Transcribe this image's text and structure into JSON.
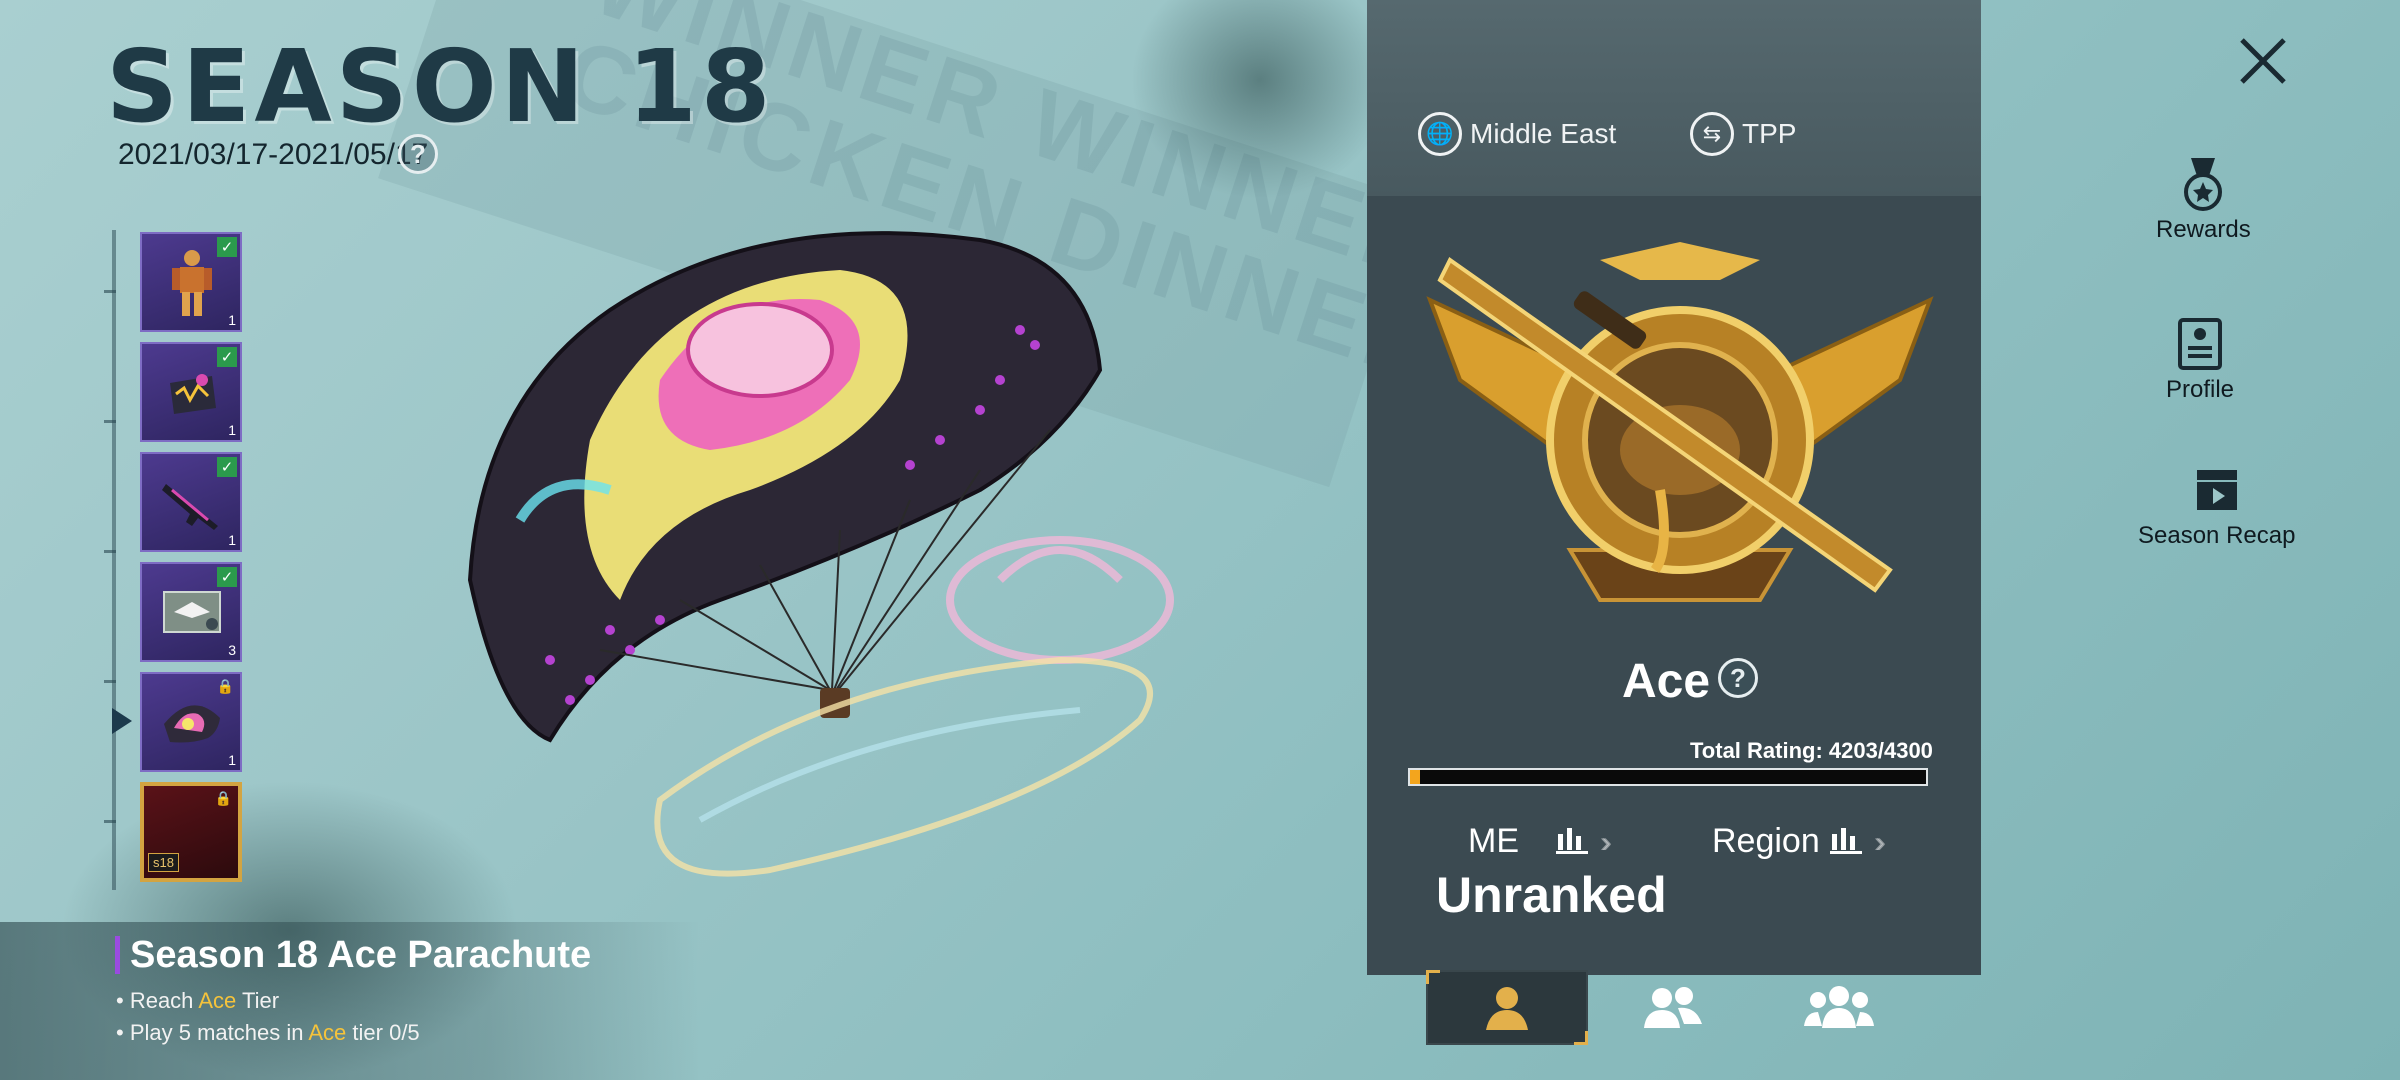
{
  "season": {
    "title": "SEASON 18",
    "dates": "2021/03/17-2021/05/17",
    "help_glyph": "?"
  },
  "rewards": [
    {
      "name": "outfit",
      "count": "1",
      "status": "claimed"
    },
    {
      "name": "backpack-skin",
      "count": "1",
      "status": "claimed"
    },
    {
      "name": "gun-skin",
      "count": "1",
      "status": "claimed"
    },
    {
      "name": "rank-card",
      "count": "3",
      "status": "claimed"
    },
    {
      "name": "parachute",
      "count": "1",
      "status": "locked"
    },
    {
      "name": "avatar-frame",
      "tag": "s18",
      "status": "locked"
    }
  ],
  "selected_item": {
    "name": "Season 18 Ace Parachute",
    "req1": {
      "prefix": "Reach ",
      "highlight": "Ace",
      "suffix": " Tier"
    },
    "req2": {
      "prefix": "Play 5 matches in ",
      "highlight": "Ace",
      "suffix": " tier 0/5"
    }
  },
  "rank": {
    "region": "Middle East",
    "mode": "TPP",
    "tier_name": "Ace",
    "help_glyph": "?",
    "total_rating_label": "Total Rating:",
    "total_rating_value": "4203/4300",
    "progress_fraction": 0.02,
    "local_label": "ME",
    "region_label": "Region",
    "standing": "Unranked"
  },
  "tabs": [
    {
      "name": "solo",
      "active": true
    },
    {
      "name": "duo",
      "active": false
    },
    {
      "name": "squad",
      "active": false
    }
  ],
  "sidebar": {
    "rewards": "Rewards",
    "profile": "Profile",
    "recap": "Season Recap"
  },
  "colors": {
    "accent_gold": "#f5c33b",
    "progress": "#f3a51d",
    "check_green": "#2b9a4c",
    "panel": "#3b4a51"
  }
}
